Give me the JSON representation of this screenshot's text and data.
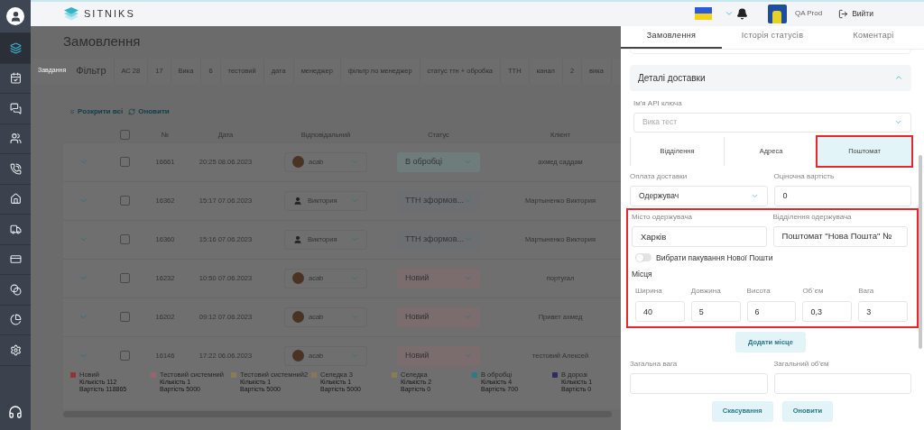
{
  "header": {
    "logo": "SITNIKS",
    "user": "QA Prod",
    "logout": "Вийти"
  },
  "sidebar": {
    "items": [
      {
        "selected": true
      },
      {
        "selected": false
      },
      {
        "selected": false
      },
      {
        "selected": false
      },
      {
        "selected": false
      },
      {
        "selected": false
      },
      {
        "selected": false
      },
      {
        "selected": false
      },
      {
        "selected": false
      },
      {
        "selected": false
      },
      {
        "selected": false
      }
    ]
  },
  "page": {
    "title": "Замовлення",
    "task_label": "Завдання",
    "filters": [
      "Фільтр",
      "АС 28",
      "17",
      "Вика",
      "6",
      "тестовий",
      "дата",
      "менеджер",
      "фільтр по менеджер",
      "статус ттн + обробка",
      "ТТН",
      "канал",
      "2",
      "вика"
    ],
    "actions": [
      "Розкрити всі",
      "Оновити"
    ]
  },
  "table": {
    "columns": [
      "№",
      "Дата",
      "Відповідальний",
      "Статус",
      "Клієнт"
    ],
    "all_checked": false,
    "rows": [
      {
        "number": "16661",
        "date": "20:25 08.06.2023",
        "manager": "acab",
        "kind": "photo",
        "status": "В обробці",
        "color": "#6f7c7c",
        "client": "ахмед саддам",
        "checked": false
      },
      {
        "number": "16362",
        "date": "15:17 07.06.2023",
        "manager": "Виктория",
        "kind": "person",
        "status": "ТТН зформов...",
        "color": "#6d6e72",
        "client": "Мартыненко Виктория",
        "checked": false
      },
      {
        "number": "16360",
        "date": "15:16 07.06.2023",
        "manager": "Виктория",
        "kind": "person",
        "status": "ТТН зформов...",
        "color": "#6d6e72",
        "client": "Мартыненко Виктория",
        "checked": false
      },
      {
        "number": "16232",
        "date": "10:50 07.06.2023",
        "manager": "acab",
        "kind": "photo",
        "status": "Новий",
        "color": "#7b6d6e",
        "client": "португал",
        "checked": false
      },
      {
        "number": "16202",
        "date": "09:12 07.06.2023",
        "manager": "acab",
        "kind": "photo",
        "status": "Новий",
        "color": "#7b6d6e",
        "client": "Привет ахмед",
        "checked": false
      },
      {
        "number": "16146",
        "date": "17:22 06.06.2023",
        "manager": "acab",
        "kind": "photo",
        "status": "Новий",
        "color": "#7b6d6e",
        "client": "тестовий Алексей",
        "checked": false
      }
    ]
  },
  "legend": [
    {
      "name": "Новий",
      "color": "#8e3535",
      "count": "Кількість 112",
      "sum": "Вартість 118865"
    },
    {
      "name": "Тестовий системний",
      "color": "#9a6367",
      "count": "Кількість 1",
      "sum": "Вартість 5000"
    },
    {
      "name": "Тестовий системний2",
      "color": "#8b7b57",
      "count": "Кількість 1",
      "sum": "Вартість 5000"
    },
    {
      "name": "Селедка 3",
      "color": "#8b7656",
      "count": "Кількість 1",
      "sum": "Вартість 5000"
    },
    {
      "name": "Селедка",
      "color": "#8d7b55",
      "count": "Кількість 2",
      "sum": "Вартість 0"
    },
    {
      "name": "В обробці",
      "color": "#2c7a86",
      "count": "Кількість 4",
      "sum": "Вартість 700"
    },
    {
      "name": "В дорозі",
      "color": "#2b2e5c",
      "count": "Кількість 1",
      "sum": "Вартість 0"
    }
  ],
  "panel": {
    "tabs": [
      {
        "label": "Замовлення",
        "selected": true
      },
      {
        "label": "Історія статусів",
        "selected": false
      },
      {
        "label": "Коментарі",
        "selected": false
      }
    ],
    "section": {
      "title": "Деталі доставки",
      "expanded": true
    },
    "api_key": {
      "label": "Ім'я API ключа",
      "placeholder": "Вика тест"
    },
    "delivery_types": [
      {
        "label": "Відділення",
        "selected": false
      },
      {
        "label": "Адреса",
        "selected": false
      },
      {
        "label": "Поштомат",
        "selected": true
      }
    ],
    "payment": {
      "label": "Оплата доставки",
      "value": "Одержувач"
    },
    "estimated": {
      "label": "Оціночна вартість",
      "value": "0"
    },
    "city": {
      "label": "Місто одержувача",
      "value": "Харків"
    },
    "branch": {
      "label": "Відділення одержувача",
      "value": "Поштомат \"Нова Пошта\" №"
    },
    "packaging": {
      "label": "Вибрати пакування Нової Пошти",
      "on": false
    },
    "places_title": "Місця",
    "places": [
      {
        "label": "Ширина",
        "value": "40"
      },
      {
        "label": "Довжина",
        "value": "5"
      },
      {
        "label": "Висота",
        "value": "6"
      },
      {
        "label": "Об`єм",
        "value": "0,3"
      },
      {
        "label": "Вага",
        "value": "3"
      }
    ],
    "add_button": "Додати місце",
    "total_weight": {
      "label": "Загальна вага"
    },
    "total_volume": {
      "label": "Загальний об'єм"
    },
    "buttons": [
      "Скасування",
      "Оновити"
    ]
  }
}
